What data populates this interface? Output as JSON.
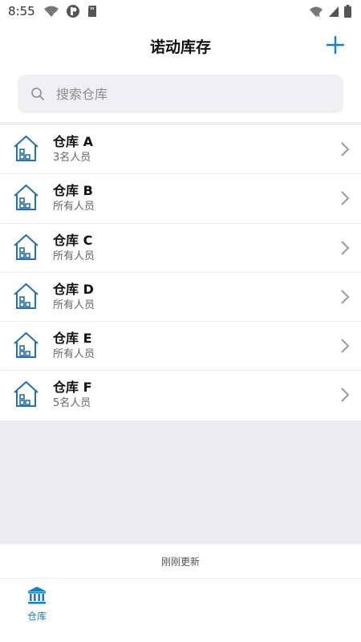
{
  "status_bar": {
    "time": "8:55",
    "icons": [
      "wifi-question-icon",
      "app-notification-icon",
      "sd-card-icon",
      "wifi-x-icon",
      "signal-icon",
      "battery-icon"
    ]
  },
  "header": {
    "title": "诺动库存",
    "add_icon": "plus-icon"
  },
  "search": {
    "placeholder": "搜索仓库"
  },
  "warehouses": [
    {
      "name": "仓库 A",
      "members": "3名人员"
    },
    {
      "name": "仓库 B",
      "members": "所有人员"
    },
    {
      "name": "仓库 C",
      "members": "所有人员"
    },
    {
      "name": "仓库 D",
      "members": "所有人员"
    },
    {
      "name": "仓库 E",
      "members": "所有人员"
    },
    {
      "name": "仓库 F",
      "members": "5名人员"
    }
  ],
  "refresh": {
    "status": "刚刚更新"
  },
  "tab_bar": {
    "tabs": [
      {
        "label": "仓库",
        "icon": "bank-icon",
        "active": true
      }
    ]
  },
  "colors": {
    "accent": "#1a7fbf",
    "icon_stroke": "#2a6fa5",
    "background_gray": "#ececf0"
  }
}
